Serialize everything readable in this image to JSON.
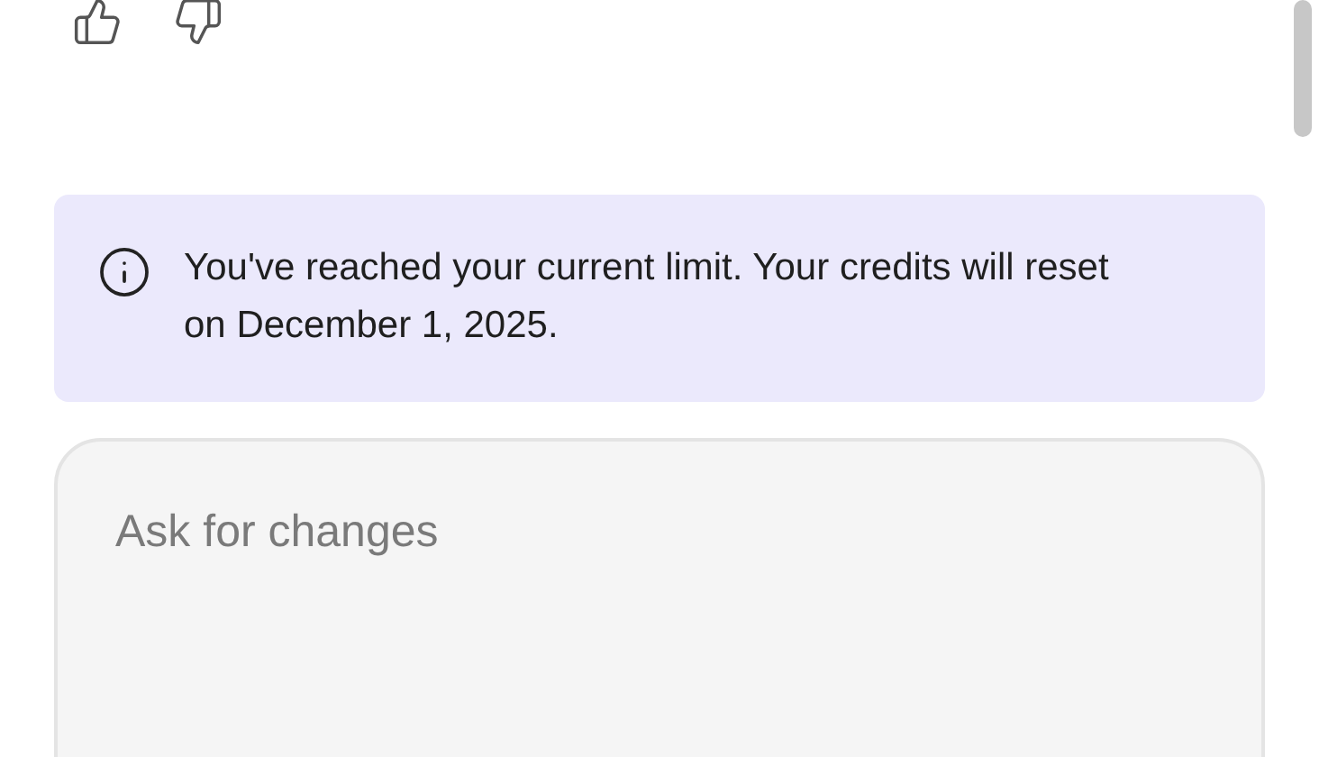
{
  "notice": {
    "text": "You've reached your current limit. Your credits will reset on December 1, 2025."
  },
  "composer": {
    "placeholder": "Ask for changes"
  }
}
